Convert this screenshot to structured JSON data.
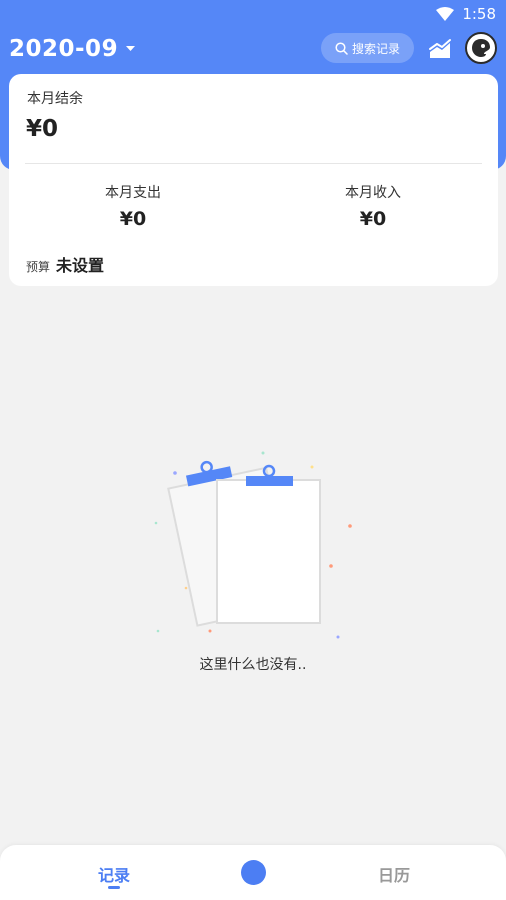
{
  "status_bar": {
    "time": "1:58"
  },
  "header": {
    "month": "2020-09",
    "search_label": "搜索记录"
  },
  "summary": {
    "balance_label": "本月结余",
    "balance_value": "¥0",
    "expense_label": "本月支出",
    "expense_value": "¥0",
    "income_label": "本月收入",
    "income_value": "¥0",
    "budget_label": "预算",
    "budget_value": "未设置"
  },
  "empty_state": {
    "message": "这里什么也没有.."
  },
  "bottom_nav": {
    "records_label": "记录",
    "calendar_label": "日历"
  },
  "colors": {
    "primary": "#5587f7",
    "accent": "#4c7ef3",
    "background": "#f2f2f2"
  },
  "icons": [
    "wifi-icon",
    "battery-icon",
    "caret-down-icon",
    "search-icon",
    "chart-icon",
    "avatar-icon",
    "clipboard-icon",
    "add-icon"
  ]
}
